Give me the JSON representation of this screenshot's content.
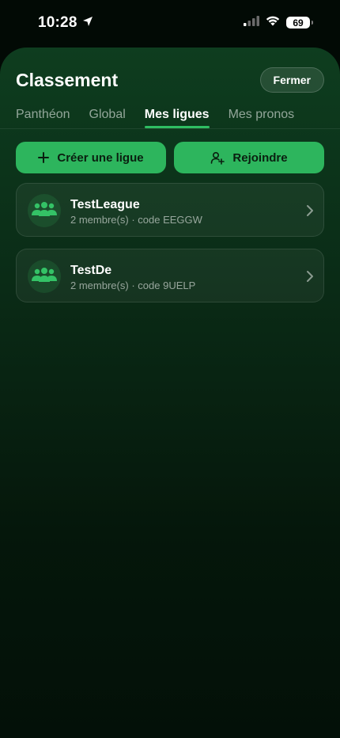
{
  "status": {
    "time": "10:28",
    "battery": "69"
  },
  "header": {
    "title": "Classement",
    "close_label": "Fermer"
  },
  "tabs": [
    {
      "label": "Panthéon",
      "active": false
    },
    {
      "label": "Global",
      "active": false
    },
    {
      "label": "Mes ligues",
      "active": true
    },
    {
      "label": "Mes pronos",
      "active": false
    }
  ],
  "actions": {
    "create_label": "Créer une ligue",
    "join_label": "Rejoindre"
  },
  "leagues": [
    {
      "name": "TestLeague",
      "members": "2 membre(s)",
      "separator": "·",
      "code": "code EEGGW"
    },
    {
      "name": "TestDe",
      "members": "2 membre(s)",
      "separator": "·",
      "code": "code 9UELP"
    }
  ],
  "colors": {
    "accent": "#2db55d",
    "sheet_top": "#0e3d1f",
    "background": "#020a05"
  }
}
